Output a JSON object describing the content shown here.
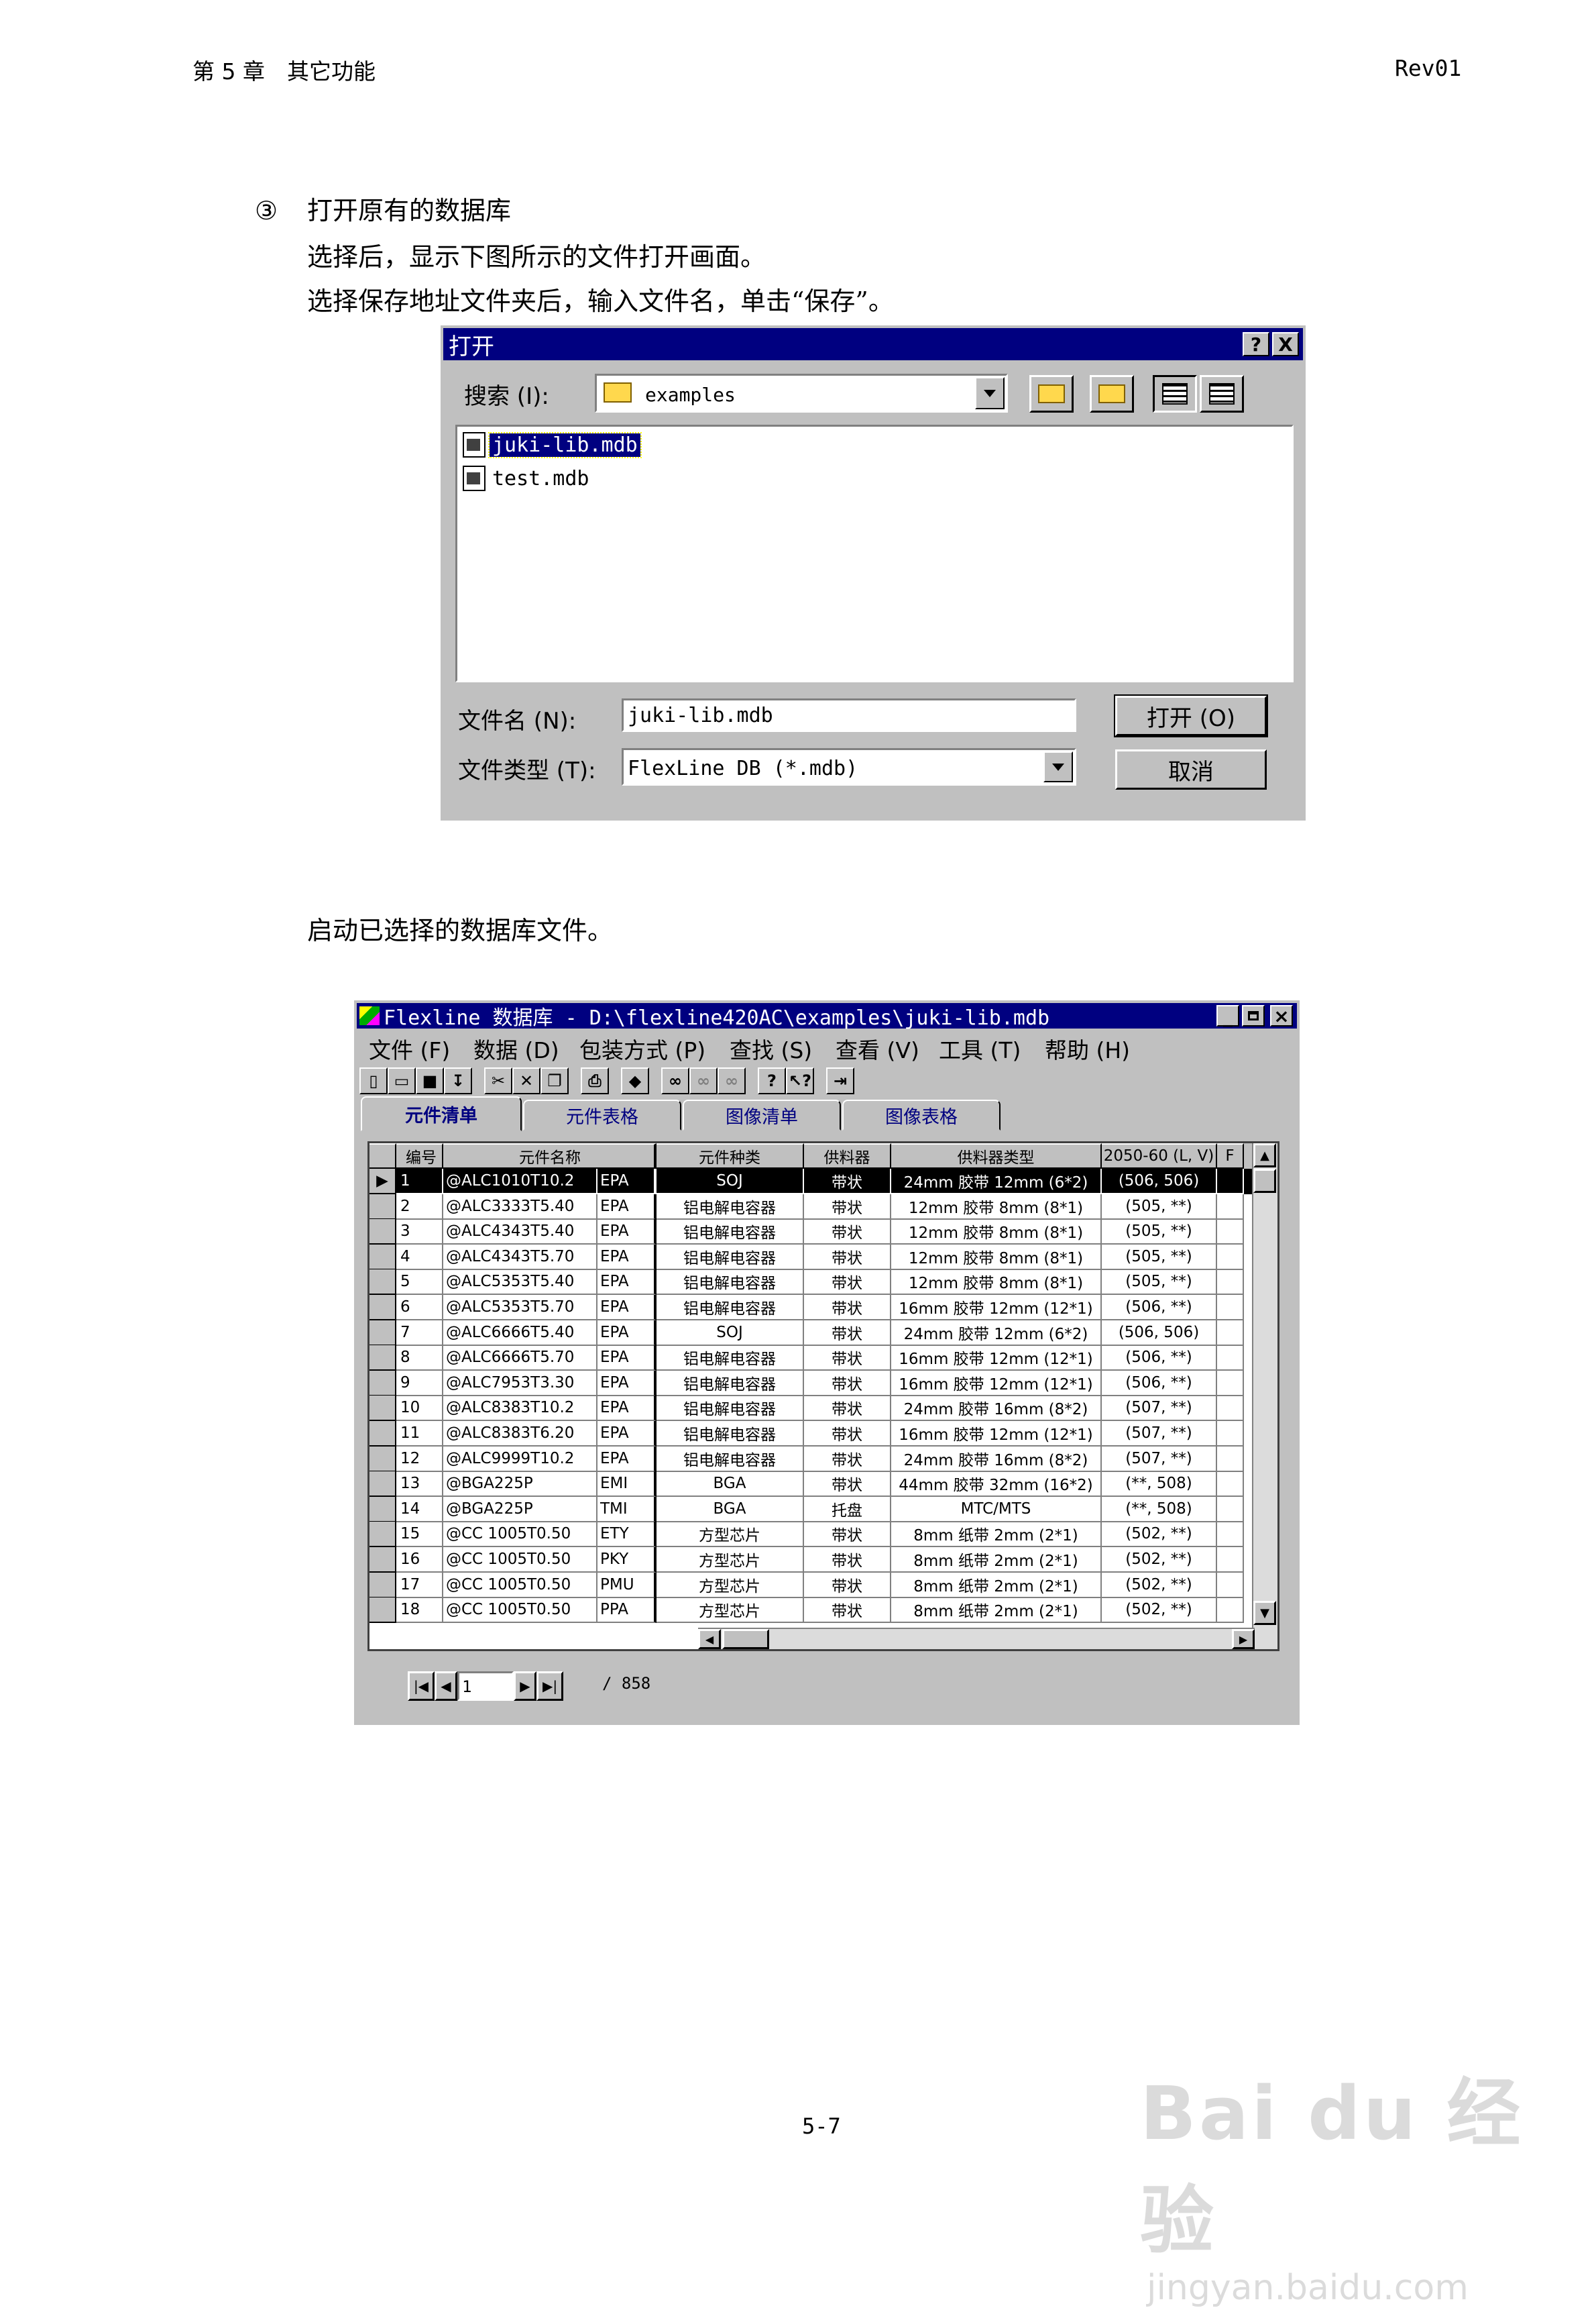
{
  "header": {
    "chapter": "第 5 章　其它功能",
    "revision": "Rev01"
  },
  "section": {
    "step_marker": "③",
    "title": "打开原有的数据库",
    "line1": "选择后，显示下图所示的文件打开画面。",
    "line2": "选择保存地址文件夹后，输入文件名，单击“保存”。",
    "after_text": "启动已选择的数据库文件。"
  },
  "open_dialog": {
    "title": "打开",
    "help_btn": "?",
    "close_btn": "X",
    "look_in_label": "搜索 (I):",
    "look_in_value": "examples",
    "files": [
      {
        "name": "juki-lib.mdb",
        "selected": true
      },
      {
        "name": "test.mdb",
        "selected": false
      }
    ],
    "filename_label": "文件名 (N):",
    "filename_value": "juki-lib.mdb",
    "filetype_label": "文件类型 (T):",
    "filetype_value": "FlexLine DB  (*.mdb)",
    "open_button": "打开 (O)",
    "cancel_button": "取消"
  },
  "db_window": {
    "title": "Flexline 数据库 - D:\\flexline420AC\\examples\\juki-lib.mdb",
    "menu": [
      "文件 (F)",
      "数据 (D)",
      "包装方式 (P)",
      "查找 (S)",
      "查看 (V)",
      "工具 (T)",
      "帮助 (H)"
    ],
    "tabs": [
      "元件清单",
      "元件表格",
      "图像清单",
      "图像表格"
    ],
    "columns": [
      "编号",
      "元件名称",
      "",
      "元件种类",
      "供料器",
      "供料器类型",
      "2050-60 (L, V)",
      "F"
    ],
    "rows": [
      [
        "1",
        "@ALC1010T10.2",
        "EPA",
        "SOJ",
        "带状",
        "24mm 胶带 12mm (6*2)",
        "(506, 506)"
      ],
      [
        "2",
        "@ALC3333T5.40",
        "EPA",
        "铝电解电容器",
        "带状",
        "12mm 胶带 8mm (8*1)",
        "(505, **)"
      ],
      [
        "3",
        "@ALC4343T5.40",
        "EPA",
        "铝电解电容器",
        "带状",
        "12mm 胶带 8mm (8*1)",
        "(505, **)"
      ],
      [
        "4",
        "@ALC4343T5.70",
        "EPA",
        "铝电解电容器",
        "带状",
        "12mm 胶带 8mm (8*1)",
        "(505, **)"
      ],
      [
        "5",
        "@ALC5353T5.40",
        "EPA",
        "铝电解电容器",
        "带状",
        "12mm 胶带 8mm (8*1)",
        "(505, **)"
      ],
      [
        "6",
        "@ALC5353T5.70",
        "EPA",
        "铝电解电容器",
        "带状",
        "16mm 胶带 12mm (12*1)",
        "(506, **)"
      ],
      [
        "7",
        "@ALC6666T5.40",
        "EPA",
        "SOJ",
        "带状",
        "24mm 胶带 12mm (6*2)",
        "(506, 506)"
      ],
      [
        "8",
        "@ALC6666T5.70",
        "EPA",
        "铝电解电容器",
        "带状",
        "16mm 胶带 12mm (12*1)",
        "(506, **)"
      ],
      [
        "9",
        "@ALC7953T3.30",
        "EPA",
        "铝电解电容器",
        "带状",
        "16mm 胶带 12mm (12*1)",
        "(506, **)"
      ],
      [
        "10",
        "@ALC8383T10.2",
        "EPA",
        "铝电解电容器",
        "带状",
        "24mm 胶带 16mm (8*2)",
        "(507, **)"
      ],
      [
        "11",
        "@ALC8383T6.20",
        "EPA",
        "铝电解电容器",
        "带状",
        "16mm 胶带 12mm (12*1)",
        "(507, **)"
      ],
      [
        "12",
        "@ALC9999T10.2",
        "EPA",
        "铝电解电容器",
        "带状",
        "24mm 胶带 16mm (8*2)",
        "(507, **)"
      ],
      [
        "13",
        "@BGA225P",
        "EMI",
        "BGA",
        "带状",
        "44mm 胶带 32mm (16*2)",
        "(**, 508)"
      ],
      [
        "14",
        "@BGA225P",
        "TMI",
        "BGA",
        "托盘",
        "MTC/MTS",
        "(**, 508)"
      ],
      [
        "15",
        "@CC 1005T0.50",
        "ETY",
        "方型芯片",
        "带状",
        "8mm 纸带 2mm (2*1)",
        "(502, **)"
      ],
      [
        "16",
        "@CC 1005T0.50",
        "PKY",
        "方型芯片",
        "带状",
        "8mm 纸带 2mm (2*1)",
        "(502, **)"
      ],
      [
        "17",
        "@CC 1005T0.50",
        "PMU",
        "方型芯片",
        "带状",
        "8mm 纸带 2mm (2*1)",
        "(502, **)"
      ],
      [
        "18",
        "@CC 1005T0.50",
        "PPA",
        "方型芯片",
        "带状",
        "8mm 纸带 2mm (2*1)",
        "(502, **)"
      ]
    ],
    "nav_record": "1",
    "nav_total": "/ 858"
  },
  "footer": {
    "page_number": "5-7"
  },
  "watermark": {
    "brand": "Bai du 经验",
    "url": "jingyan.baidu.com"
  }
}
